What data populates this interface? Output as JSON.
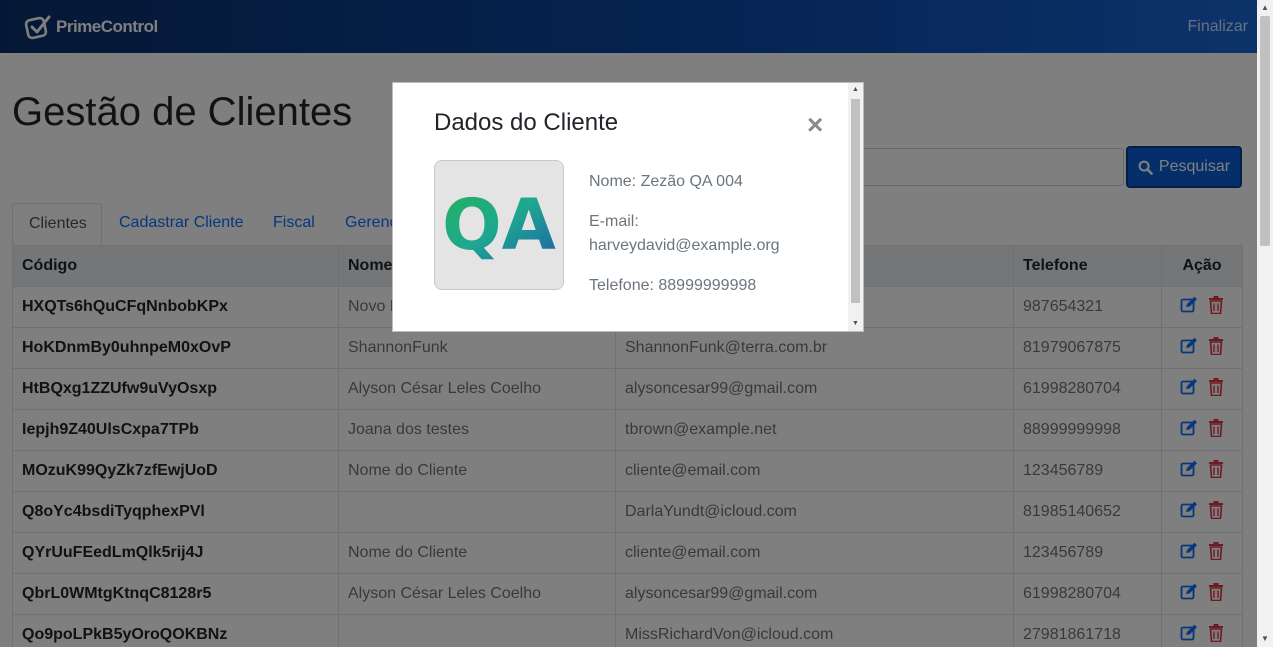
{
  "header": {
    "brand": "PrimeControl",
    "logout_label": "Finalizar"
  },
  "main": {
    "title": "Gestão de Clientes",
    "search": {
      "placeholder": "",
      "button_label": "Pesquisar"
    },
    "tabs": [
      {
        "label": "Clientes",
        "active": true
      },
      {
        "label": "Cadastrar Cliente",
        "active": false
      },
      {
        "label": "Fiscal",
        "active": false
      },
      {
        "label": "Gerenc",
        "active": false
      }
    ],
    "table": {
      "columns": [
        "Código",
        "Nome",
        "",
        "Telefone",
        "Ação"
      ],
      "rows": [
        {
          "code": "HXQTs6hQuCFqNnbobKPx",
          "name": "Novo N",
          "email": "",
          "phone": "987654321"
        },
        {
          "code": "HoKDnmBy0uhnpeM0xOvP",
          "name": "ShannonFunk",
          "email": "ShannonFunk@terra.com.br",
          "phone": "81979067875"
        },
        {
          "code": "HtBQxg1ZZUfw9uVyOsxp",
          "name": "Alyson César Leles Coelho",
          "email": "alysoncesar99@gmail.com",
          "phone": "61998280704"
        },
        {
          "code": "Iepjh9Z40UlsCxpa7TPb",
          "name": "Joana dos testes",
          "email": "tbrown@example.net",
          "phone": "88999999998"
        },
        {
          "code": "MOzuK99QyZk7zfEwjUoD",
          "name": "Nome do Cliente",
          "email": "cliente@email.com",
          "phone": "123456789"
        },
        {
          "code": "Q8oYc4bsdiTyqphexPVl",
          "name": "",
          "email": "DarlaYundt@icloud.com",
          "phone": "81985140652"
        },
        {
          "code": "QYrUuFEedLmQlk5rij4J",
          "name": "Nome do Cliente",
          "email": "cliente@email.com",
          "phone": "123456789"
        },
        {
          "code": "QbrL0WMtgKtnqC8128r5",
          "name": "Alyson César Leles Coelho",
          "email": "alysoncesar99@gmail.com",
          "phone": "61998280704"
        },
        {
          "code": "Qo9poLPkB5yOroQOKBNz",
          "name": "",
          "email": "MissRichardVon@icloud.com",
          "phone": "27981861718"
        }
      ]
    }
  },
  "modal": {
    "title": "Dados do Cliente",
    "close_label": "×",
    "avatar_text": "QA",
    "name_line": "Nome: Zezão QA 004",
    "email_label": "E-mail:",
    "email_value": "harveydavid@example.org",
    "phone_line": "Telefone: 88999999998"
  },
  "icons": {
    "brand": "check-square-icon",
    "search": "search-icon",
    "edit": "edit-icon",
    "delete": "trash-icon",
    "close": "close-icon"
  },
  "colors": {
    "navbar_start": "#0a2f6b",
    "navbar_end": "#1a66d6",
    "primary": "#0d6efd",
    "danger": "#dc3545"
  }
}
